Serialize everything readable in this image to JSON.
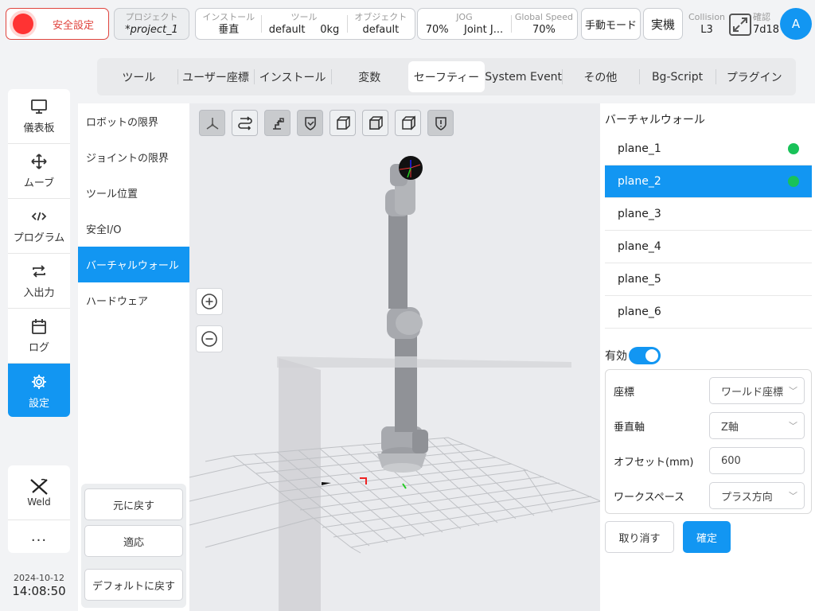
{
  "header": {
    "safety_label": "安全設定",
    "project": {
      "key": "プロジェクト",
      "value": "*project_1"
    },
    "install": {
      "k1": "インストール",
      "v1": "垂直",
      "k2": "ツール",
      "v2a": "default",
      "v2b": "0kg",
      "k3": "オブジェクト",
      "v3": "default"
    },
    "jog": {
      "k1": "JOG",
      "v1a": "70%",
      "v1b": "Joint J...",
      "k2": "Global Speed",
      "v2": "70%"
    },
    "manual_mode": "手動モード",
    "real_machine": "実機",
    "collision": {
      "key": "Collision",
      "value": "L3"
    },
    "confirm": {
      "key": "確認",
      "value": "7d18"
    },
    "avatar": "A"
  },
  "leftnav": {
    "items": [
      {
        "label": "儀表板",
        "icon": "monitor-icon"
      },
      {
        "label": "ムーブ",
        "icon": "move-arrows-icon"
      },
      {
        "label": "プログラム",
        "icon": "code-icon"
      },
      {
        "label": "入出力",
        "icon": "io-arrows-icon"
      },
      {
        "label": "ログ",
        "icon": "calendar-icon"
      },
      {
        "label": "設定",
        "icon": "gear-icon",
        "active": true
      }
    ],
    "weld": "Weld",
    "more": "...",
    "date": "2024-10-12",
    "time": "14:08:50"
  },
  "tabs": [
    "ツール",
    "ユーザー座標",
    "インストール",
    "変数",
    "セーフティー",
    "System Event",
    "その他",
    "Bg-Script",
    "プラグイン"
  ],
  "active_tab": "セーフティー",
  "submenu": {
    "items": [
      "ロボットの限界",
      "ジョイントの限界",
      "ツール位置",
      "安全I/O",
      "バーチャルウォール",
      "ハードウェア"
    ],
    "active": "バーチャルウォール",
    "revert": "元に戻す",
    "apply": "適応",
    "default": "デフォルトに戻す"
  },
  "viewport": {
    "tools": [
      "axes-view-icon",
      "path-view-icon",
      "robot-arm-view-icon",
      "shield-check-icon",
      "cube-view-icon",
      "cube-front-icon",
      "cube-side-icon",
      "shield-alert-icon"
    ]
  },
  "panel": {
    "title": "バーチャルウォール",
    "planes": [
      "plane_1",
      "plane_2",
      "plane_3",
      "plane_4",
      "plane_5",
      "plane_6"
    ],
    "active_plane": "plane_2",
    "enable_label": "有効",
    "enabled": true,
    "coord_label": "座標",
    "coord_value": "ワールド座標",
    "axis_label": "垂直軸",
    "axis_value": "Z軸",
    "offset_label": "オフセット(mm)",
    "offset_value": "600",
    "workspace_label": "ワークスペース",
    "workspace_value": "プラス方向",
    "cancel": "取り消す",
    "ok": "確定"
  },
  "colors": {
    "accent": "#1296f2",
    "danger": "#e0443e",
    "status_ok": "#19c259"
  }
}
